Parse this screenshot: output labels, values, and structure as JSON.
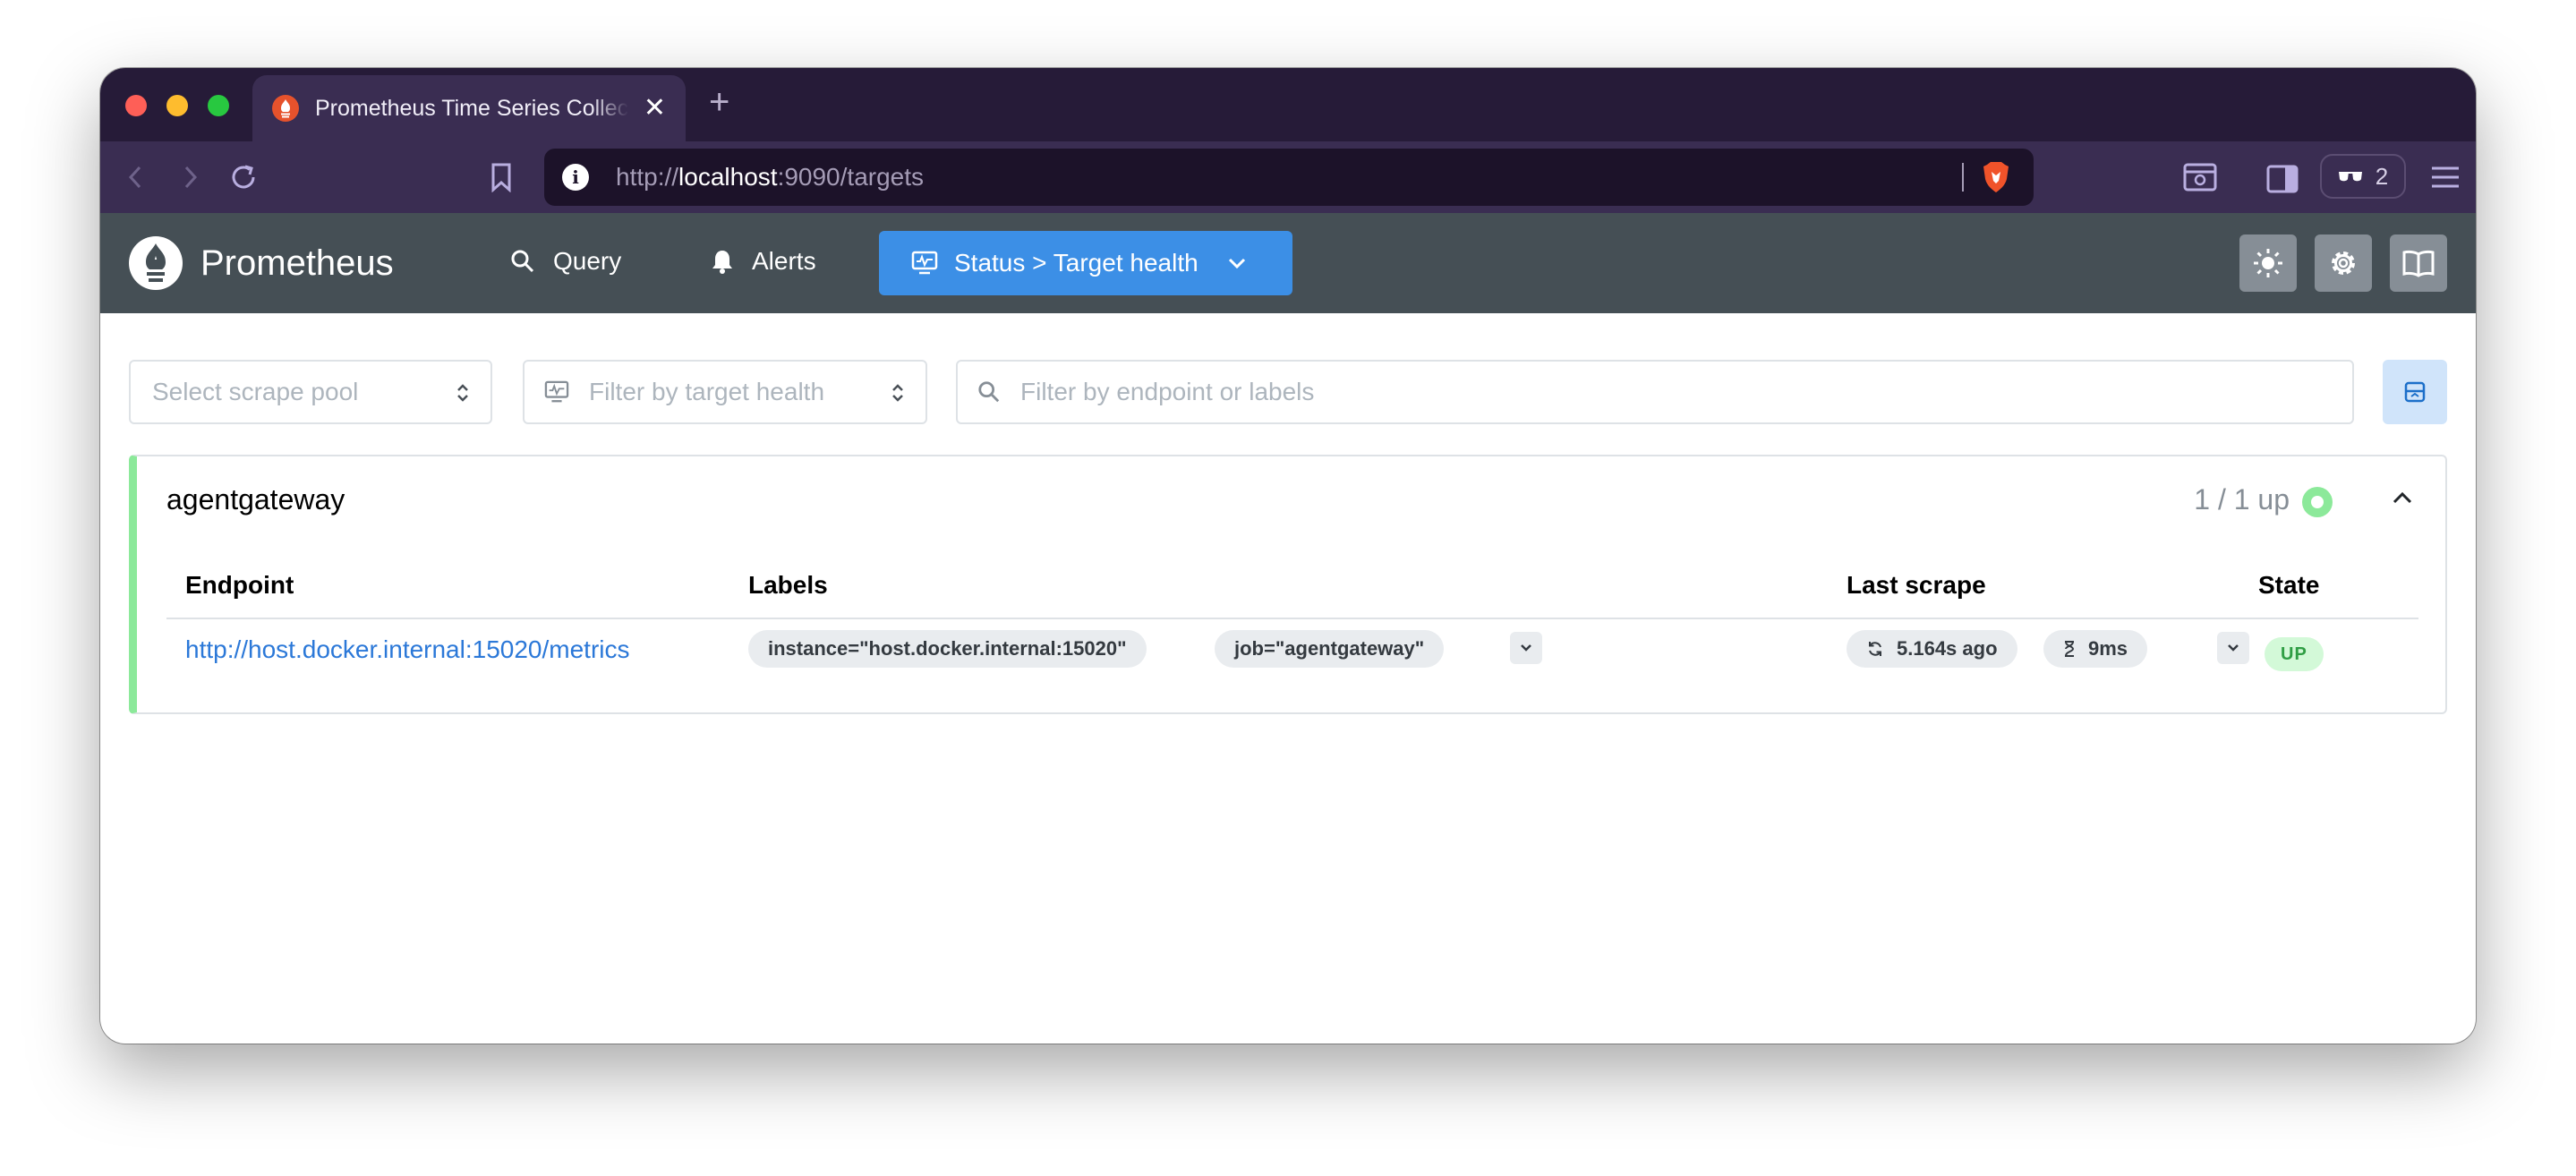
{
  "browser": {
    "tab_title": "Prometheus Time Series Collection and Processing Server",
    "new_tab": "+",
    "close_tab": "✕",
    "url_scheme": "http://",
    "url_host": "localhost",
    "url_rest": ":9090/targets",
    "shield_count": "2"
  },
  "header": {
    "brand": "Prometheus",
    "nav": {
      "query": "Query",
      "alerts": "Alerts",
      "status": "Status > Target health"
    }
  },
  "filters": {
    "scrape_pool_placeholder": "Select scrape pool",
    "health_placeholder": "Filter by target health",
    "search_placeholder": "Filter by endpoint or labels"
  },
  "pool": {
    "name": "agentgateway",
    "health": "1 / 1 up",
    "columns": {
      "endpoint": "Endpoint",
      "labels": "Labels",
      "last_scrape": "Last scrape",
      "state": "State"
    },
    "targets": [
      {
        "endpoint": "http://host.docker.internal:15020/metrics",
        "labels": [
          "instance=\"host.docker.internal:15020\"",
          "job=\"agentgateway\""
        ],
        "last_scrape": "5.164s ago",
        "duration": "9ms",
        "state": "UP"
      }
    ]
  },
  "colors": {
    "accent": "#3c8fe6",
    "header_bg": "#454f55",
    "up_green": "#8ce99a",
    "link": "#2b78d8"
  },
  "icons": [
    "prometheus-logo-icon",
    "search-icon",
    "bell-icon",
    "monitor-icon",
    "chevron-down-icon",
    "sun-icon",
    "gear-icon",
    "book-icon",
    "refresh-icon",
    "hourglass-icon",
    "chevron-up-icon",
    "layout-collapse-icon"
  ]
}
